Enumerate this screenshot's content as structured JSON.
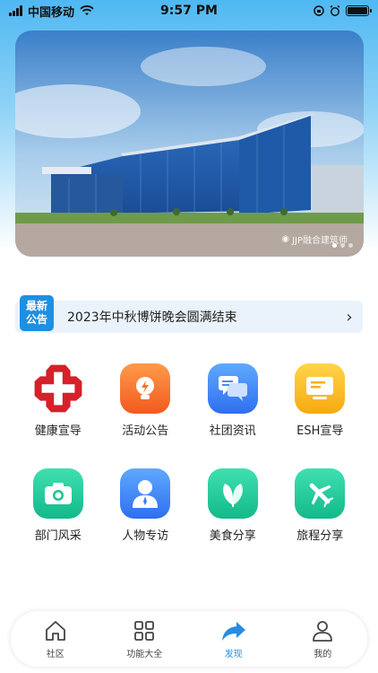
{
  "status_bar": {
    "carrier": "中国移动",
    "time": "9:57 PM"
  },
  "banner": {
    "watermark": "JJP融合建筑师",
    "slides": 3,
    "active_slide": 1
  },
  "notice": {
    "tag_line1": "最新",
    "tag_line2": "公告",
    "text": "2023年中秋博饼晚会圆满结束",
    "arrow": "›"
  },
  "grid": {
    "row1": [
      {
        "label": "健康宣导",
        "icon": "red-cross-icon"
      },
      {
        "label": "活动公告",
        "icon": "lightbulb-icon"
      },
      {
        "label": "社团资讯",
        "icon": "chat-icon"
      },
      {
        "label": "ESH宣导",
        "icon": "screen-icon"
      }
    ],
    "row2": [
      {
        "label": "部门风采",
        "icon": "camera-icon"
      },
      {
        "label": "人物专访",
        "icon": "person-icon"
      },
      {
        "label": "美食分享",
        "icon": "leaf-icon"
      },
      {
        "label": "旅程分享",
        "icon": "airplane-icon"
      }
    ]
  },
  "tabbar": {
    "items": [
      {
        "label": "社区",
        "icon": "home-icon"
      },
      {
        "label": "功能大全",
        "icon": "grid-icon"
      },
      {
        "label": "发现",
        "icon": "share-arrow-icon"
      },
      {
        "label": "我的",
        "icon": "user-icon"
      }
    ],
    "active": "发现"
  },
  "colors": {
    "accent": "#2a8ce0",
    "notice_tag": "#1f8fe0",
    "notice_bg": "#eaf3fb"
  }
}
